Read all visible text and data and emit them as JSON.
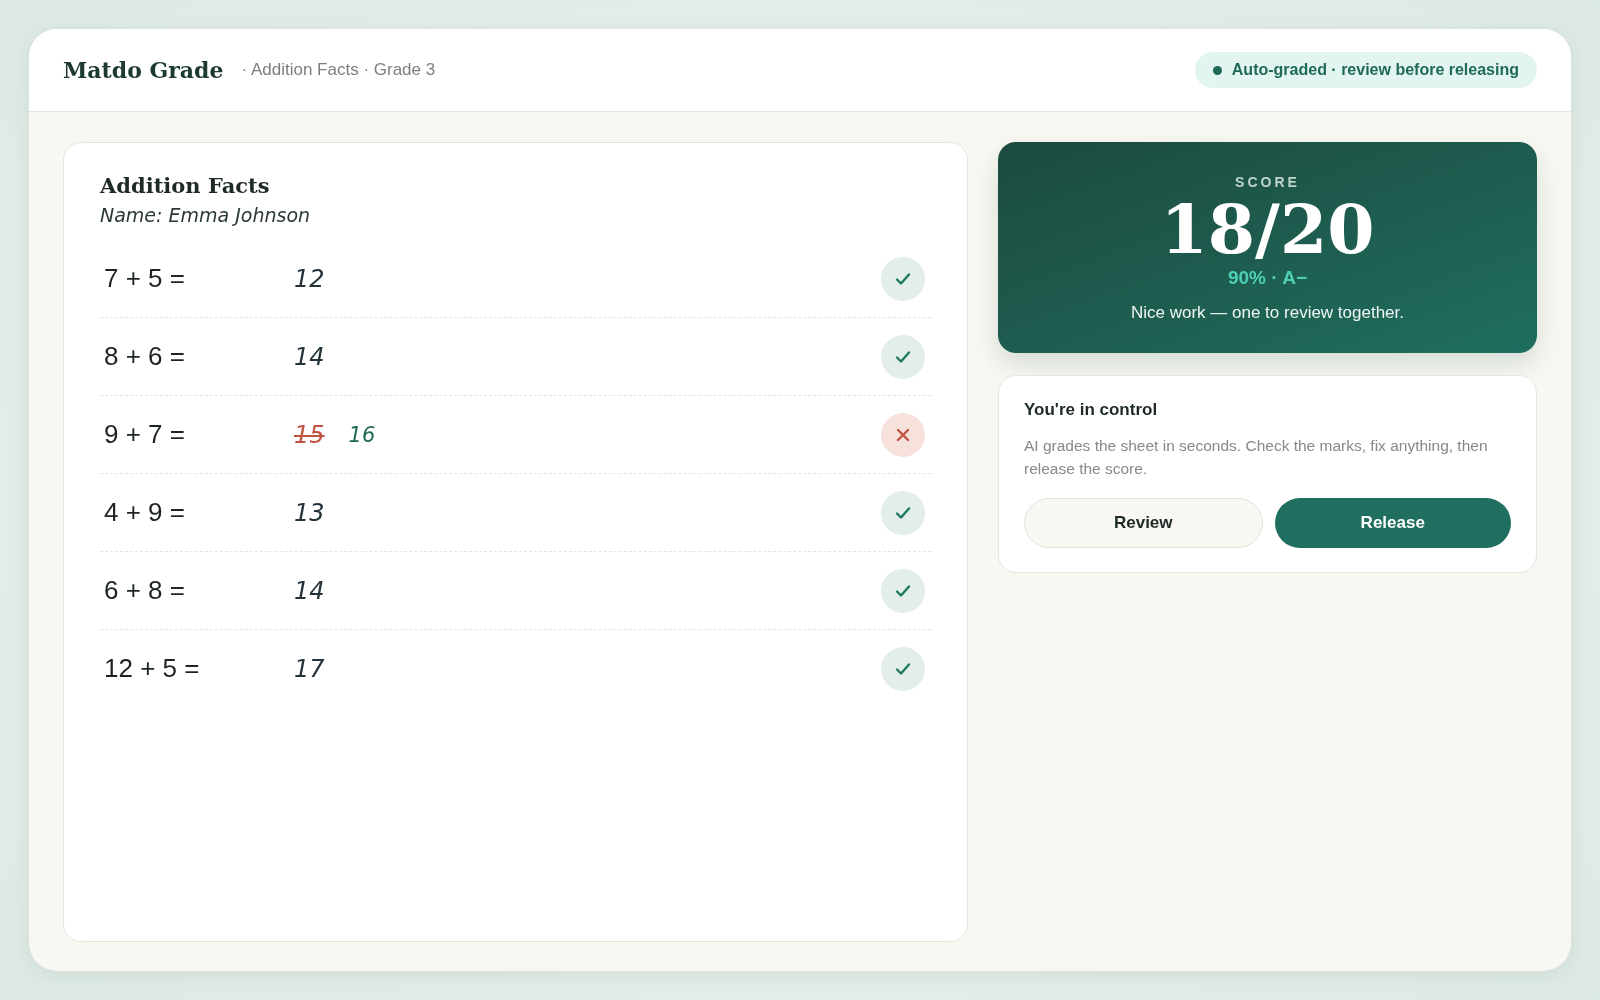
{
  "app": {
    "brand": "Matdo Grade",
    "breadcrumb": "· Addition Facts · Grade 3",
    "status_badge": "Auto-graded · review before releasing"
  },
  "sheet": {
    "title": "Addition Facts",
    "student": "Name: Emma Johnson",
    "problems": [
      {
        "question": "7 + 5 =",
        "answer": "12",
        "correct": true
      },
      {
        "question": "8 + 6 =",
        "answer": "14",
        "correct": true
      },
      {
        "question": "9 + 7 =",
        "answer": "15",
        "correct": false,
        "correction": "16"
      },
      {
        "question": "4 + 9 =",
        "answer": "13",
        "correct": true
      },
      {
        "question": "6 + 8 =",
        "answer": "14",
        "correct": true
      },
      {
        "question": "12 + 5 =",
        "answer": "17",
        "correct": true
      }
    ]
  },
  "score": {
    "label": "SCORE",
    "value": "18/20",
    "grade": "90% · A−",
    "message": "Nice work — one to review together."
  },
  "control": {
    "title": "You're in control",
    "text": "AI grades the sheet in seconds. Check the marks, fix anything, then release the score.",
    "buttons": [
      {
        "label": "Review",
        "kind": "secondary"
      },
      {
        "label": "Release",
        "kind": "primary"
      }
    ]
  }
}
